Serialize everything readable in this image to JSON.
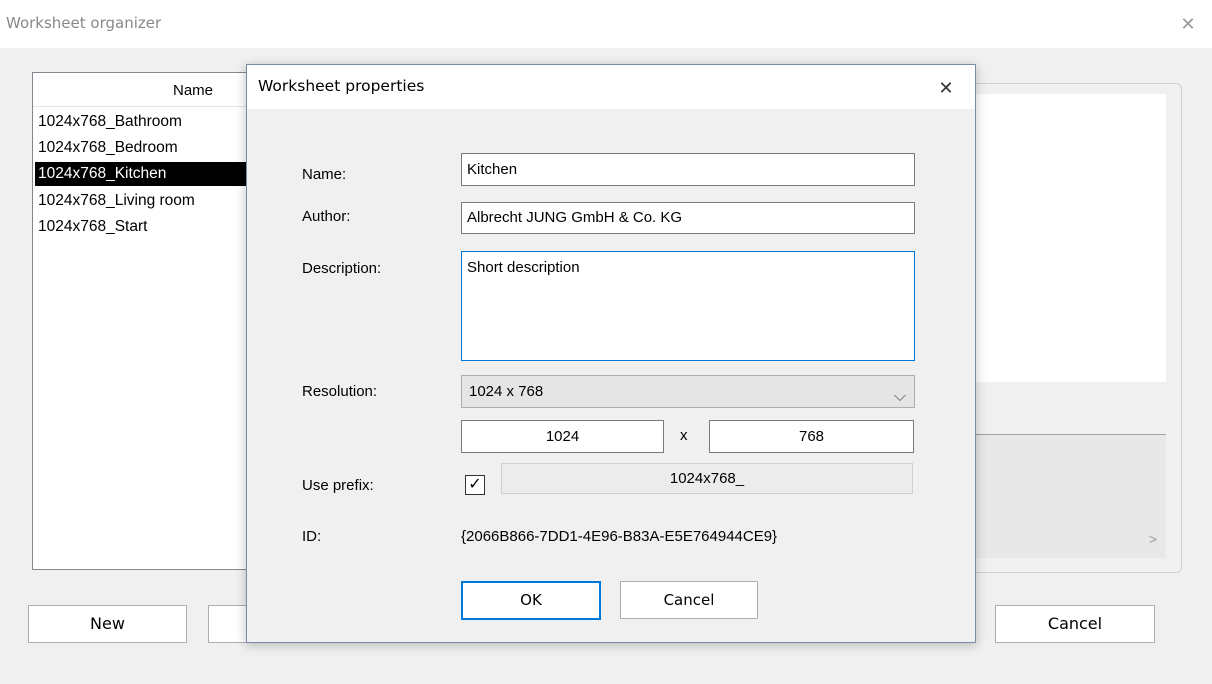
{
  "outer": {
    "title": "Worksheet organizer",
    "close_glyph": "✕",
    "list_header": "Name",
    "items": [
      "1024x768_Bathroom",
      "1024x768_Bedroom",
      "1024x768_Kitchen",
      "1024x768_Living room",
      "1024x768_Start"
    ],
    "selected_index": 2,
    "new_label": "New",
    "cancel_label": "Cancel",
    "scroll_right_glyph": ">"
  },
  "dialog": {
    "title": "Worksheet properties",
    "close_glyph": "✕",
    "name_label": "Name:",
    "name_value": "Kitchen",
    "author_label": "Author:",
    "author_value": "Albrecht JUNG GmbH & Co. KG",
    "description_label": "Description:",
    "description_value": "Short description",
    "resolution_label": "Resolution:",
    "resolution_value": "1024 x 768",
    "width_value": "1024",
    "x_separator": "x",
    "height_value": "768",
    "prefix_label": "Use prefix:",
    "prefix_checked": true,
    "check_glyph": "✓",
    "prefix_value": "1024x768_",
    "id_label": "ID:",
    "id_value": "{2066B866-7DD1-4E96-B83A-E5E764944CE9}",
    "ok_label": "OK",
    "cancel_label": "Cancel",
    "chevron_glyph": "⌵"
  }
}
